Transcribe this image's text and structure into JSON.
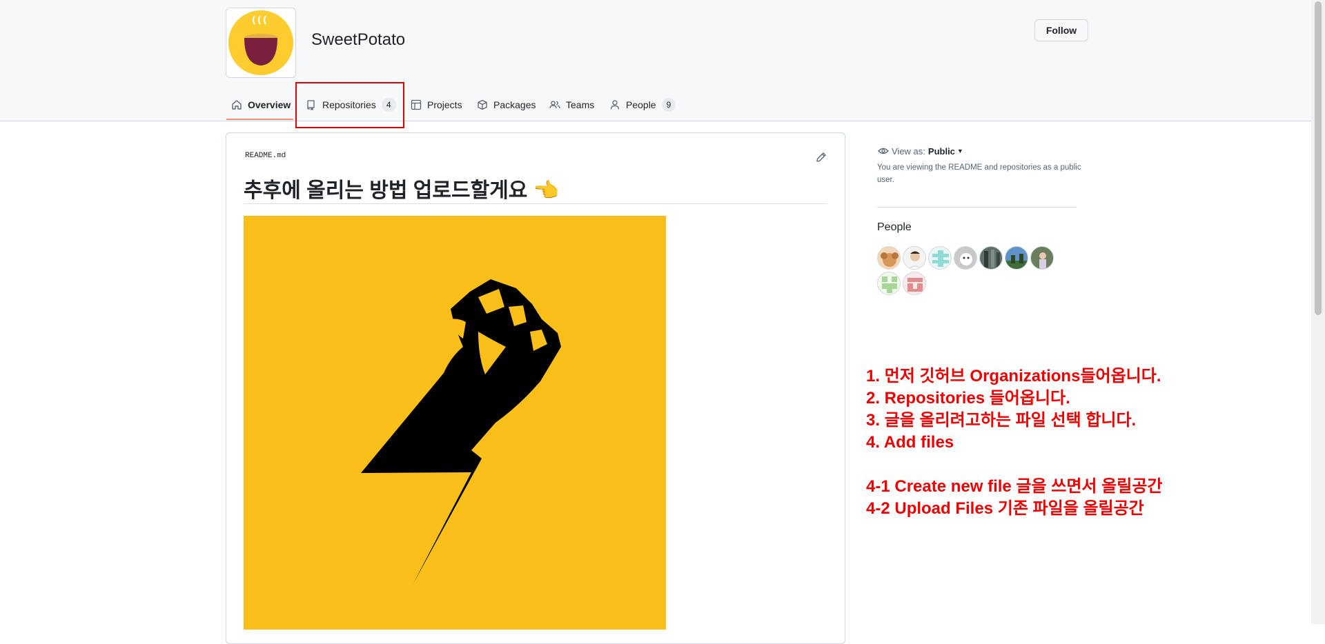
{
  "org": {
    "name": "SweetPotato",
    "follow_label": "Follow"
  },
  "tabs": [
    {
      "label": "Overview",
      "icon": "home-icon",
      "active": true
    },
    {
      "label": "Repositories",
      "icon": "repo-icon",
      "count": "4"
    },
    {
      "label": "Projects",
      "icon": "table-icon"
    },
    {
      "label": "Packages",
      "icon": "package-icon"
    },
    {
      "label": "Teams",
      "icon": "people-icon"
    },
    {
      "label": "People",
      "icon": "person-icon",
      "count": "9"
    }
  ],
  "readme": {
    "filename": "README.md",
    "heading": "추후에 올리는 방법 업로드할게요",
    "heading_emoji": "👈",
    "image_icon": "raised-fist-lightning-image"
  },
  "sidebar": {
    "view_as_label": "View as:",
    "view_as_value": "Public",
    "view_note": "You are viewing the README and repositories as a public user.",
    "people_title": "People"
  },
  "annotation": {
    "lines": [
      "1. 먼저 깃허브 Organizations들어옵니다.",
      "2. Repositories 들어옵니다.",
      "3. 글을 올리려고하는 파일 선택 합니다.",
      "4. Add files",
      "",
      "4-1 Create new file 글을 쓰면서 올릴공간",
      "4-2 Upload Files 기존 파일을 올릴공간"
    ]
  },
  "colors": {
    "accent_tab": "#fd8c73",
    "annotation_red": "#ee0000",
    "readme_image_bg": "#fbbf1a"
  }
}
